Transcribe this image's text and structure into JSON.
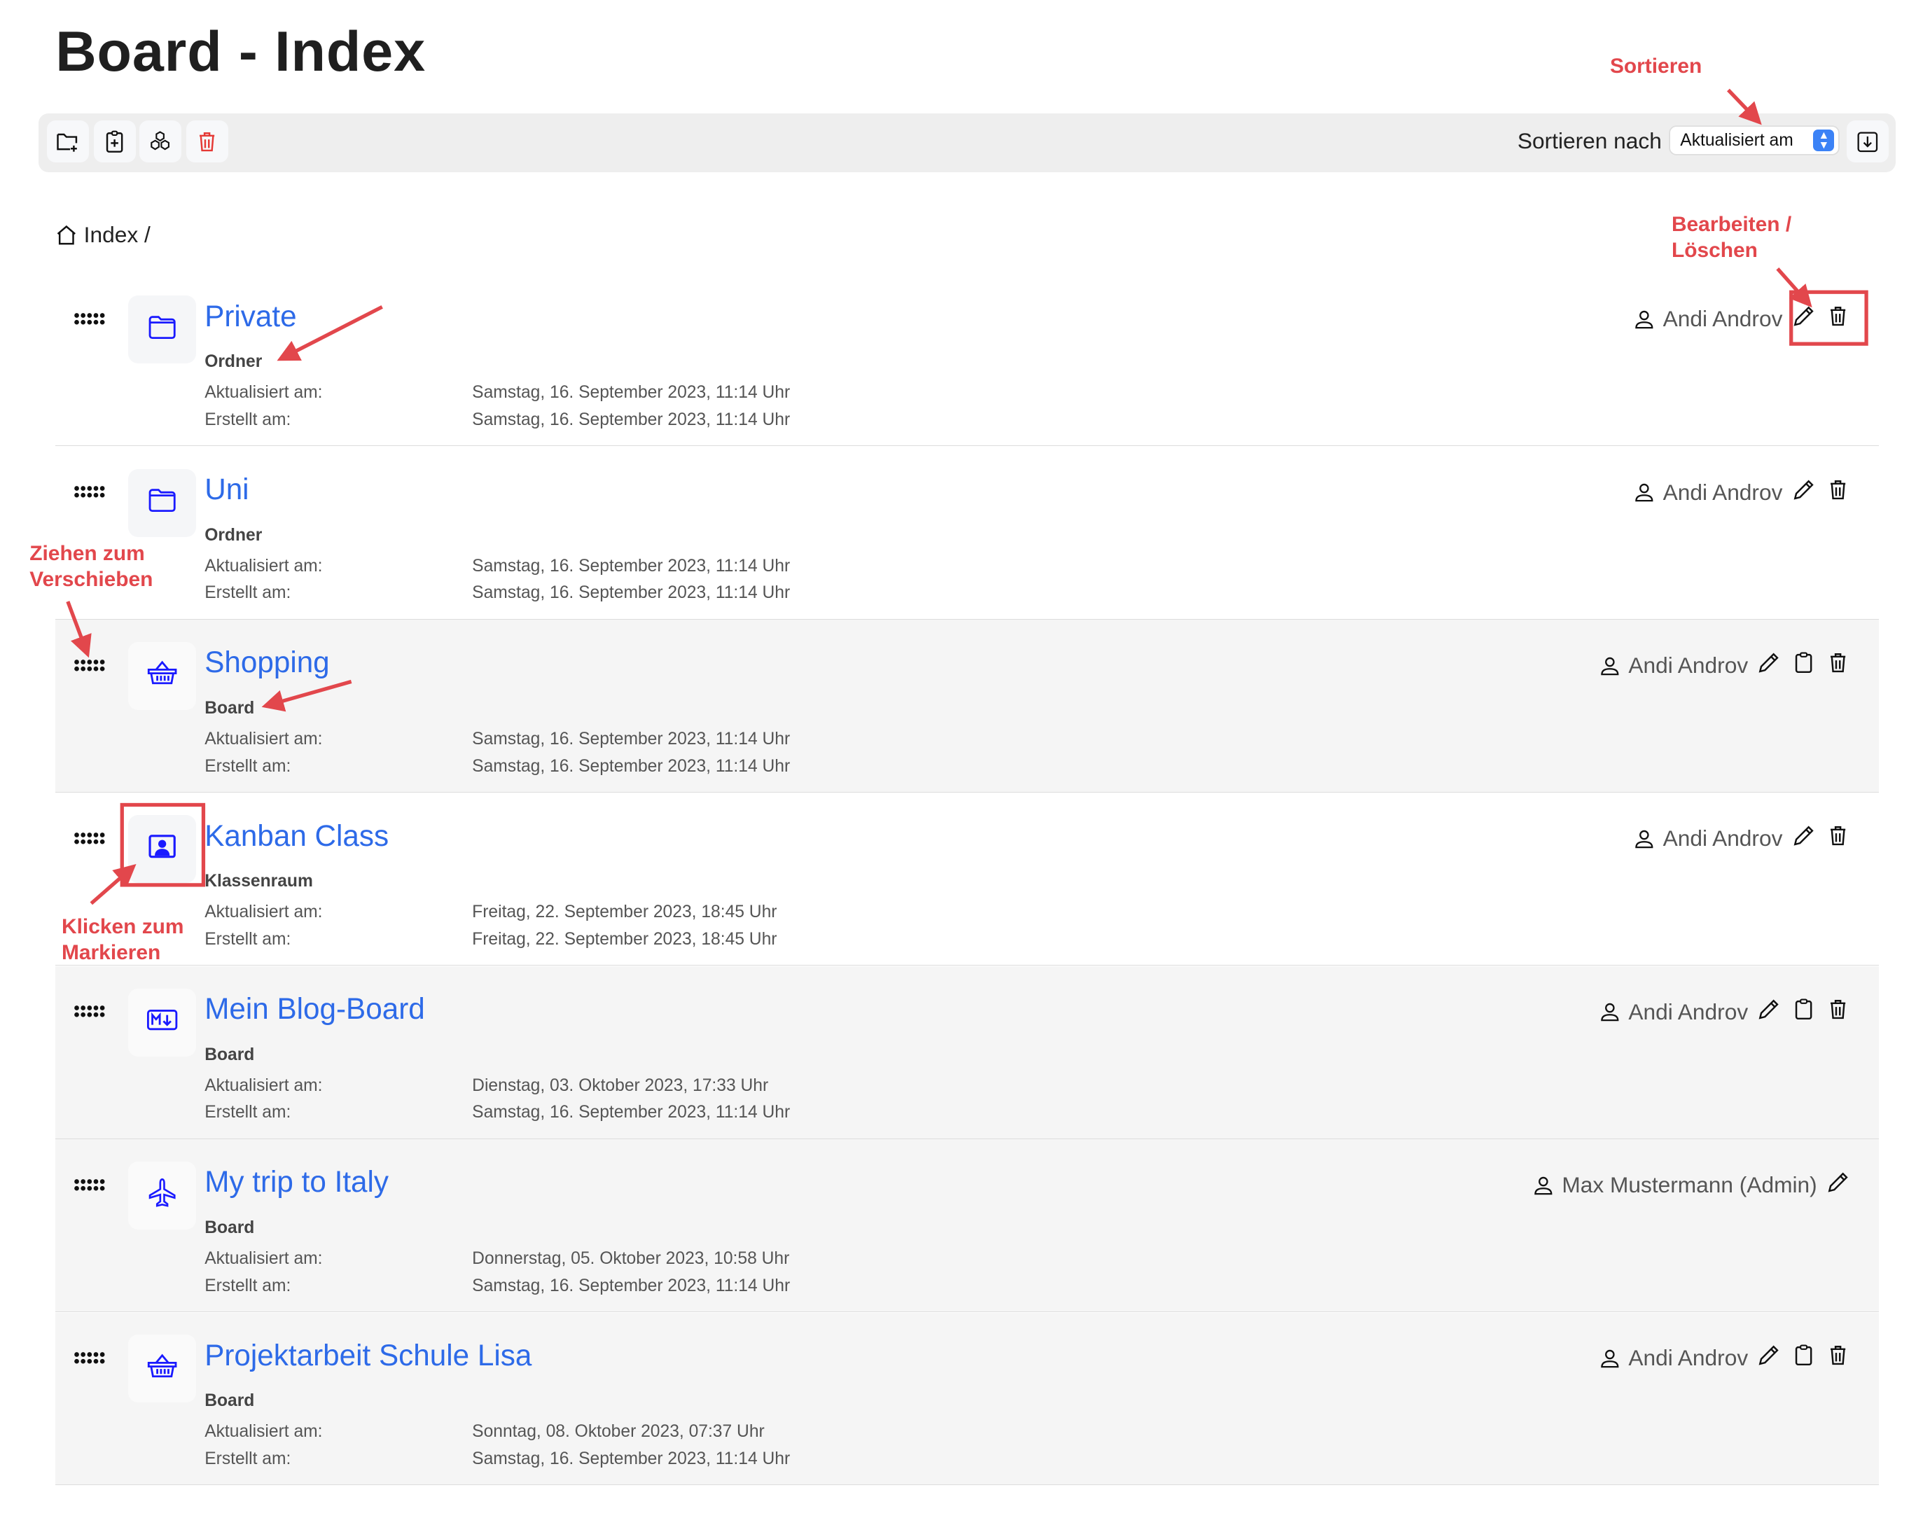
{
  "page_title": "Board - Index",
  "toolbar": {
    "buttons": [
      {
        "icon": "folder-plus-icon"
      },
      {
        "icon": "clipboard-plus-icon"
      },
      {
        "icon": "cubes-icon"
      },
      {
        "icon": "trash-icon",
        "color": "#e53935"
      }
    ],
    "sort_label": "Sortieren nach",
    "sort_value": "Aktualisiert am",
    "sort_direction_icon": "arrow-down-icon"
  },
  "breadcrumb": {
    "icon": "home-icon",
    "label": "Index",
    "separator": "/"
  },
  "labels": {
    "updated": "Aktualisiert am:",
    "created": "Erstellt am:"
  },
  "items": [
    {
      "title": "Private",
      "type": "Ordner",
      "icon": "folder-icon",
      "updated": "Samstag, 16. September 2023, 11:14 Uhr",
      "created": "Samstag, 16. September 2023, 11:14 Uhr",
      "owner": "Andi Androv",
      "actions": [
        "edit",
        "delete"
      ]
    },
    {
      "title": "Uni",
      "type": "Ordner",
      "icon": "folder-icon",
      "updated": "Samstag, 16. September 2023, 11:14 Uhr",
      "created": "Samstag, 16. September 2023, 11:14 Uhr",
      "owner": "Andi Androv",
      "actions": [
        "edit",
        "delete"
      ]
    },
    {
      "title": "Shopping",
      "type": "Board",
      "icon": "basket-icon",
      "updated": "Samstag, 16. September 2023, 11:14 Uhr",
      "created": "Samstag, 16. September 2023, 11:14 Uhr",
      "owner": "Andi Androv",
      "actions": [
        "edit",
        "copy",
        "delete"
      ]
    },
    {
      "title": "Kanban Class",
      "type": "Klassenraum",
      "icon": "classroom-icon",
      "updated": "Freitag, 22. September 2023, 18:45 Uhr",
      "created": "Freitag, 22. September 2023, 18:45 Uhr",
      "owner": "Andi Androv",
      "actions": [
        "edit",
        "delete"
      ]
    },
    {
      "title": "Mein Blog-Board",
      "type": "Board",
      "icon": "markdown-icon",
      "updated": "Dienstag, 03. Oktober 2023, 17:33 Uhr",
      "created": "Samstag, 16. September 2023, 11:14 Uhr",
      "owner": "Andi Androv",
      "actions": [
        "edit",
        "copy",
        "delete"
      ]
    },
    {
      "title": "My trip to Italy",
      "type": "Board",
      "icon": "airplane-icon",
      "updated": "Donnerstag, 05. Oktober 2023, 10:58 Uhr",
      "created": "Samstag, 16. September 2023, 11:14 Uhr",
      "owner": "Max Mustermann (Admin)",
      "actions": [
        "edit"
      ]
    },
    {
      "title": "Projektarbeit Schule Lisa",
      "type": "Board",
      "icon": "basket-icon",
      "updated": "Sonntag, 08. Oktober 2023, 07:37 Uhr",
      "created": "Samstag, 16. September 2023, 11:14 Uhr",
      "owner": "Andi Androv",
      "actions": [
        "edit",
        "copy",
        "delete"
      ]
    }
  ],
  "annotations": {
    "sort": "Sortieren",
    "edit_delete_1": "Bearbeiten /",
    "edit_delete_2": "Löschen",
    "drag_1": "Ziehen zum",
    "drag_2": "Verschieben",
    "select_1": "Klicken zum",
    "select_2": "Markieren",
    "color": "#e2474c"
  },
  "colors": {
    "link": "#2d6ae8",
    "icon": "#1a1aff",
    "board_row_bg": "#f5f5f5",
    "toolbar_bg": "#eeeeee"
  }
}
